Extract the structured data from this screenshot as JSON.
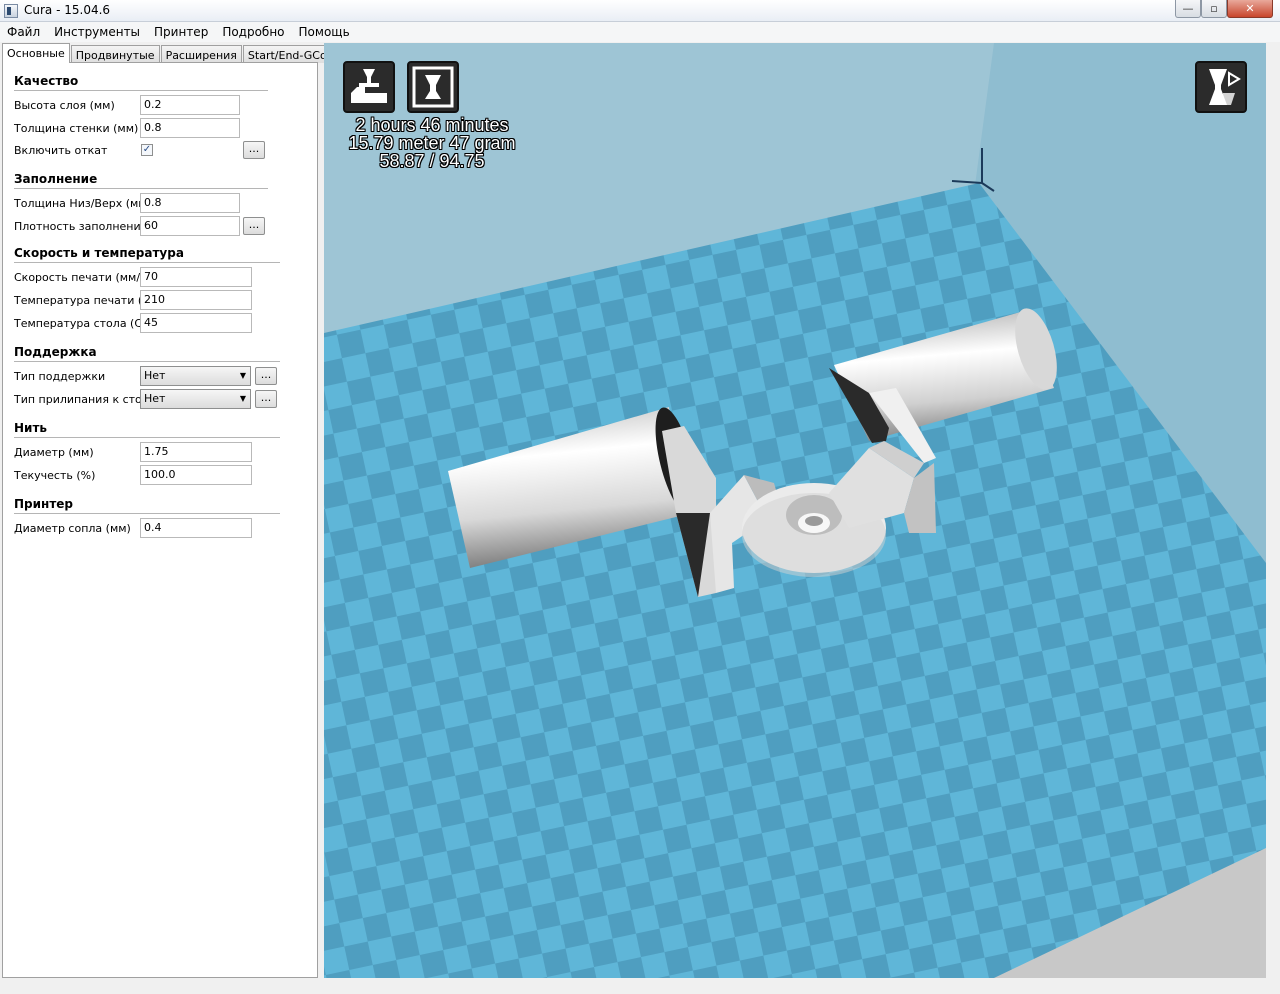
{
  "window": {
    "title": "Cura - 15.04.6",
    "min_glyph": "—",
    "max_glyph": "▫",
    "close_glyph": "✕"
  },
  "menu": [
    "Файл",
    "Инструменты",
    "Принтер",
    "Подробно",
    "Помощь"
  ],
  "tabs": [
    "Основные",
    "Продвинутые",
    "Расширения",
    "Start/End-GCode"
  ],
  "active_tab": 0,
  "sections": {
    "quality": {
      "title": "Качество",
      "layer_height": {
        "label": "Высота слоя (мм)",
        "value": "0.2"
      },
      "shell_thickness": {
        "label": "Толщина стенки (мм)",
        "value": "0.8"
      },
      "retraction": {
        "label": "Включить откат",
        "checked": "✓"
      }
    },
    "fill": {
      "title": "Заполнение",
      "bottom_top": {
        "label": "Толщина Низ/Верх (мм)",
        "value": "0.8"
      },
      "density": {
        "label": "Плотность заполнения",
        "value": "60"
      }
    },
    "speed": {
      "title": "Скорость и температура",
      "print_speed": {
        "label": "Скорость печати (мм/с)",
        "value": "70"
      },
      "print_temp": {
        "label": "Температура печати (C)",
        "value": "210"
      },
      "bed_temp": {
        "label": "Температура стола (C)",
        "value": "45"
      }
    },
    "support": {
      "title": "Поддержка",
      "support_type": {
        "label": "Тип поддержки",
        "value": "Нет"
      },
      "adhesion": {
        "label": "Тип прилипания к столу",
        "value": "Нет"
      }
    },
    "filament": {
      "title": "Нить",
      "diameter": {
        "label": "Диаметр (мм)",
        "value": "1.75"
      },
      "flow": {
        "label": "Текучесть (%)",
        "value": "100.0"
      }
    },
    "machine": {
      "title": "Принтер",
      "nozzle": {
        "label": "Диаметр сопла (мм)",
        "value": "0.4"
      }
    }
  },
  "buttons": {
    "dots": "..."
  },
  "print_info": {
    "time": "2 hours 46 minutes",
    "material": "15.79 meter 47 gram",
    "size": "58.87 / 94.75"
  },
  "colors": {
    "bed_light": "#5fb6d8",
    "bed_dark": "#4f9ec0",
    "background": "#9ec5d5",
    "model": "#f2f2f2"
  }
}
